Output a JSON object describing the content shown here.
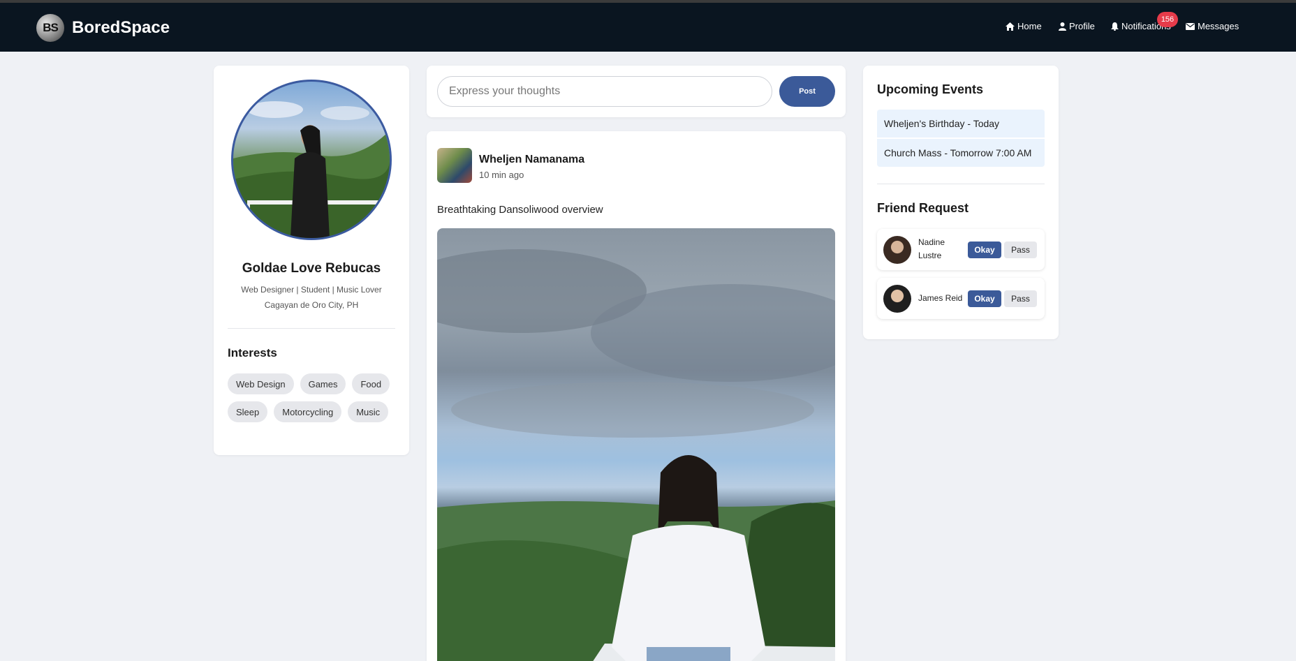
{
  "app": {
    "logo_text": "BS",
    "name": "BoredSpace"
  },
  "nav": {
    "home": "Home",
    "profile": "Profile",
    "notifications": "Notifications",
    "notification_count": "156",
    "messages": "Messages",
    "icons": [
      "home-icon",
      "user-icon",
      "bell-icon",
      "envelope-icon"
    ]
  },
  "profile": {
    "name": "Goldae Love Rebucas",
    "tagline": "Web Designer | Student | Music Lover",
    "location": "Cagayan de Oro City, PH",
    "interests_title": "Interests",
    "interests": [
      "Web Design",
      "Games",
      "Food",
      "Sleep",
      "Motorcycling",
      "Music"
    ]
  },
  "composer": {
    "placeholder": "Express your thoughts",
    "value": "",
    "post_label": "Post"
  },
  "feed": {
    "posts": [
      {
        "author": "Wheljen Namanama",
        "time": "10 min ago",
        "text": "Breathtaking Dansoliwood overview"
      }
    ]
  },
  "events": {
    "title": "Upcoming Events",
    "items": [
      "Wheljen's Birthday - Today",
      "Church Mass - Tomorrow 7:00 AM"
    ]
  },
  "friend_requests": {
    "title": "Friend Request",
    "items": [
      {
        "name": "Nadine Lustre",
        "accept": "Okay",
        "reject": "Pass"
      },
      {
        "name": "James Reid",
        "accept": "Okay",
        "reject": "Pass"
      }
    ]
  },
  "colors": {
    "navbar": "#0a1520",
    "accent": "#3b5a99",
    "badge": "#e63b4a",
    "background": "#eff1f5"
  }
}
